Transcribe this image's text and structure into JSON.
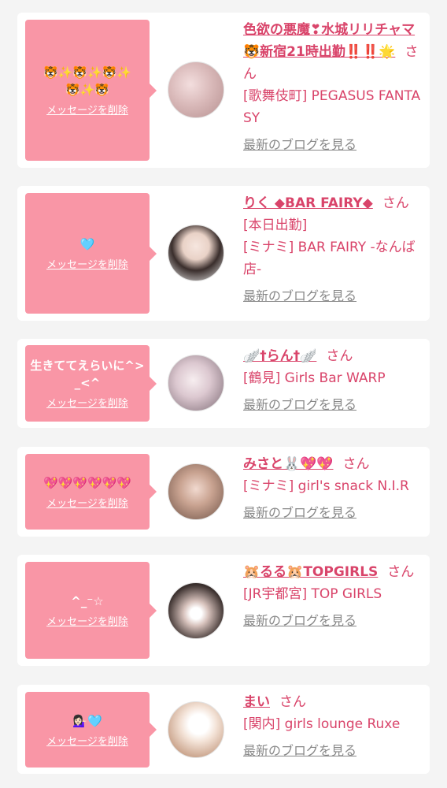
{
  "colors": {
    "bubble": "#f996a6",
    "accent": "#d9446a",
    "muted": "#888888",
    "background": "#f4f4f4"
  },
  "delete_label": "メッセージを削除",
  "blog_label": "最新のブログを見る",
  "san_label": "さん",
  "cards": [
    {
      "bubble_message": "🐯✨🐯✨🐯✨🐯✨🐯",
      "name": "色欲の悪魔❣水城リリチャマ🐯新宿21時出勤‼️‼️🌟",
      "details": [
        "[歌舞伎町] PEGASUS FANTASY"
      ],
      "avatar_icon": "portrait-photo"
    },
    {
      "bubble_message": "🩵",
      "name": "りく ◆BAR FAIRY◆",
      "details": [
        "[本日出勤]",
        "[ミナミ] BAR FAIRY -なんば店-"
      ],
      "avatar_icon": "portrait-photo"
    },
    {
      "bubble_message": "生きててえらいに^>_<^",
      "name": "🪽†らん†🪽",
      "details": [
        "[鶴見] Girls Bar WARP"
      ],
      "avatar_icon": "portrait-photo"
    },
    {
      "bubble_message": "💖💖💖💖💖💖",
      "name": "みさと🐰💖💖",
      "details": [
        "[ミナミ] girl's snack N.I.R"
      ],
      "avatar_icon": "portrait-photo"
    },
    {
      "bubble_message": "^_⁻☆",
      "name": "🐹るる🐹TOPGIRLS",
      "details": [
        "[JR宇都宮] TOP GIRLS"
      ],
      "avatar_icon": "portrait-photo"
    },
    {
      "bubble_message": "💁🏻‍♀️🩵",
      "name": "まい",
      "details": [
        "[関内] girls lounge Ruxe"
      ],
      "avatar_icon": "portrait-photo"
    }
  ]
}
